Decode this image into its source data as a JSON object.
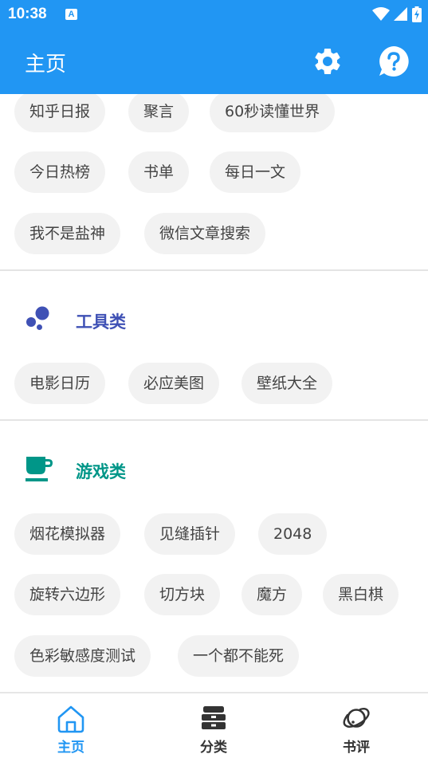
{
  "status_bar": {
    "time": "10:38",
    "notification_badge": "A"
  },
  "app_bar": {
    "title": "主页"
  },
  "sections": {
    "reading": {
      "chips": [
        "知乎日报",
        "聚言",
        "60秒读懂世界",
        "今日热榜",
        "书单",
        "每日一文",
        "我不是盐神",
        "微信文章搜索"
      ]
    },
    "tools": {
      "title": "工具类",
      "color": "#3F51B5",
      "chips": [
        "电影日历",
        "必应美图",
        "壁纸大全"
      ]
    },
    "games": {
      "title": "游戏类",
      "color": "#009688",
      "chips": [
        "烟花模拟器",
        "见缝插针",
        "2048",
        "旋转六边形",
        "切方块",
        "魔方",
        "黑白棋",
        "色彩敏感度测试",
        "一个都不能死"
      ]
    }
  },
  "bottom_nav": {
    "items": [
      {
        "label": "主页",
        "icon": "home-icon",
        "active": true
      },
      {
        "label": "分类",
        "icon": "category-stack-icon",
        "active": false
      },
      {
        "label": "书评",
        "icon": "planet-icon",
        "active": false
      }
    ],
    "active_color": "#2196F3",
    "inactive_color": "#333333"
  },
  "colors": {
    "primary": "#2196F3",
    "chip_bg": "#f2f2f2"
  }
}
